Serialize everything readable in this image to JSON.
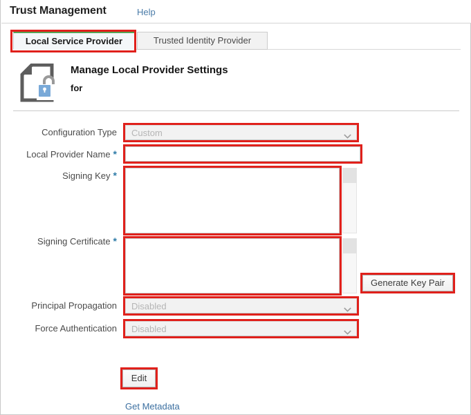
{
  "header": {
    "title": "Trust Management",
    "help_label": "Help"
  },
  "tabs": [
    {
      "id": "local-service-provider",
      "label": "Local Service Provider",
      "active": true
    },
    {
      "id": "trusted-identity-provider",
      "label": "Trusted Identity Provider",
      "active": false
    }
  ],
  "heading": {
    "icon": "document-lock-icon",
    "title": "Manage Local Provider Settings",
    "subtitle": "for"
  },
  "form": {
    "configuration_type": {
      "label": "Configuration Type",
      "value": "Custom",
      "control": "dropdown",
      "disabled": true,
      "required": false
    },
    "local_provider_name": {
      "label": "Local Provider Name",
      "value": "",
      "control": "text",
      "required": true,
      "required_marker": "*"
    },
    "signing_key": {
      "label": "Signing Key",
      "value": "",
      "control": "textarea",
      "required": true,
      "required_marker": "*"
    },
    "signing_certificate": {
      "label": "Signing Certificate",
      "value": "",
      "control": "textarea",
      "required": true,
      "required_marker": "*"
    },
    "principal_propagation": {
      "label": "Principal Propagation",
      "value": "Disabled",
      "control": "dropdown",
      "disabled": true,
      "required": false
    },
    "force_authentication": {
      "label": "Force Authentication",
      "value": "Disabled",
      "control": "dropdown",
      "disabled": true,
      "required": false
    }
  },
  "actions": {
    "generate_key_pair": "Generate Key Pair",
    "edit": "Edit",
    "get_metadata": "Get Metadata"
  },
  "colors": {
    "highlight_red": "#e0201b",
    "active_tab_accent": "#54a254",
    "link_blue": "#3b6fa0",
    "required_star_blue": "#2f7ca8",
    "disabled_text": "#b5b5b5"
  }
}
